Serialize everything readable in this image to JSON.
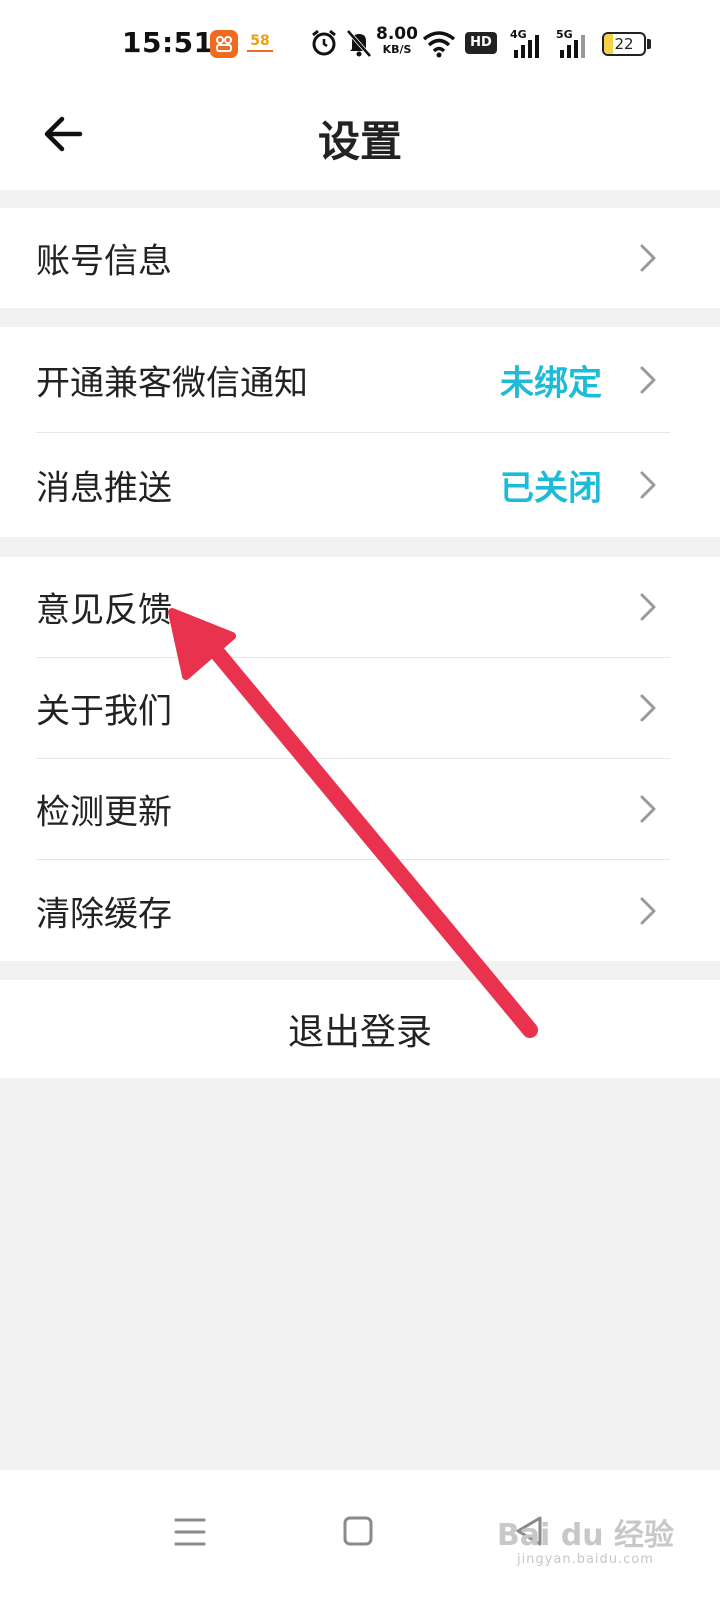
{
  "status_bar": {
    "time": "15:51",
    "app2_badge": "58",
    "speed_value": "8.00",
    "speed_unit": "KB/S",
    "hd_label": "HD",
    "net1_label": "4G",
    "net2_label": "5G",
    "battery": "22",
    "battery_level": 0.22,
    "icons": [
      "app-badge-icon",
      "alarm-icon",
      "mute-bell-icon",
      "wifi-icon",
      "hd-icon",
      "signal-4g-icon",
      "signal-5g-icon",
      "battery-icon"
    ]
  },
  "header": {
    "title": "设置"
  },
  "colors": {
    "accent": "#1ebbd7",
    "background": "#f2f2f2",
    "arrow": "#e8324e"
  },
  "settings": {
    "account_info": "账号信息",
    "wechat_notify": "开通兼客微信通知",
    "wechat_notify_status": "未绑定",
    "message_push": "消息推送",
    "message_push_status": "已关闭",
    "feedback": "意见反馈",
    "about_us": "关于我们",
    "check_update": "检测更新",
    "clear_cache": "清除缓存"
  },
  "logout": {
    "label": "退出登录"
  },
  "watermark": {
    "brand": "Bai du 经验",
    "url": "jingyan.baidu.com"
  }
}
